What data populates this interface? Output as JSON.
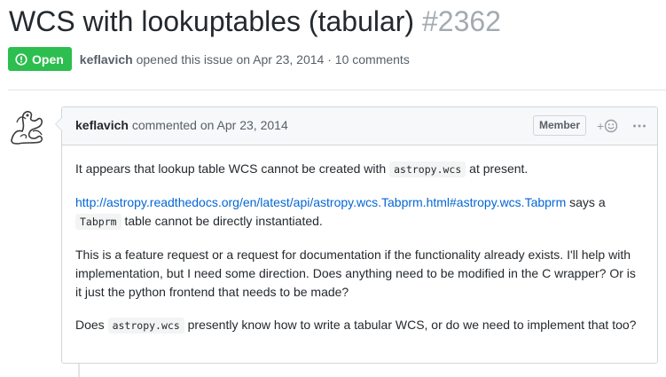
{
  "issue": {
    "title": "WCS with lookuptables (tabular)",
    "number": "#2362",
    "state_label": "Open",
    "author": "keflavich",
    "opened_text": "opened this issue on Apr 23, 2014",
    "separator": "·",
    "comments_count": "10 comments"
  },
  "comment": {
    "author": "keflavich",
    "action_text": "commented on Apr 23, 2014",
    "role_badge": "Member",
    "reaction_plus": "+",
    "body": {
      "p1_before": "It appears that lookup table WCS cannot be created with",
      "p1_code": "astropy.wcs",
      "p1_after": "at present.",
      "p2_link": "http://astropy.readthedocs.org/en/latest/api/astropy.wcs.Tabprm.html#astropy.wcs.Tabprm",
      "p2_after_link": "says a",
      "p2_code": "Tabprm",
      "p2_after_code": "table cannot be directly instantiated.",
      "p3": "This is a feature request or a request for documentation if the functionality already exists. I'll help with implementation, but I need some direction. Does anything need to be modified in the C wrapper? Or is it just the python frontend that needs to be made?",
      "p4_before": "Does",
      "p4_code": "astropy.wcs",
      "p4_after": "presently know how to write a tabular WCS, or do we need to implement that too?"
    }
  },
  "colors": {
    "open_green": "#2cbe4e",
    "link_blue": "#0366d6",
    "muted_text": "#586069",
    "border": "#d1d5da"
  },
  "icons": {
    "state": "issue-opened-icon",
    "reaction": "smiley-icon",
    "more": "kebab-horizontal-icon",
    "avatar": "identicon-avatar"
  }
}
